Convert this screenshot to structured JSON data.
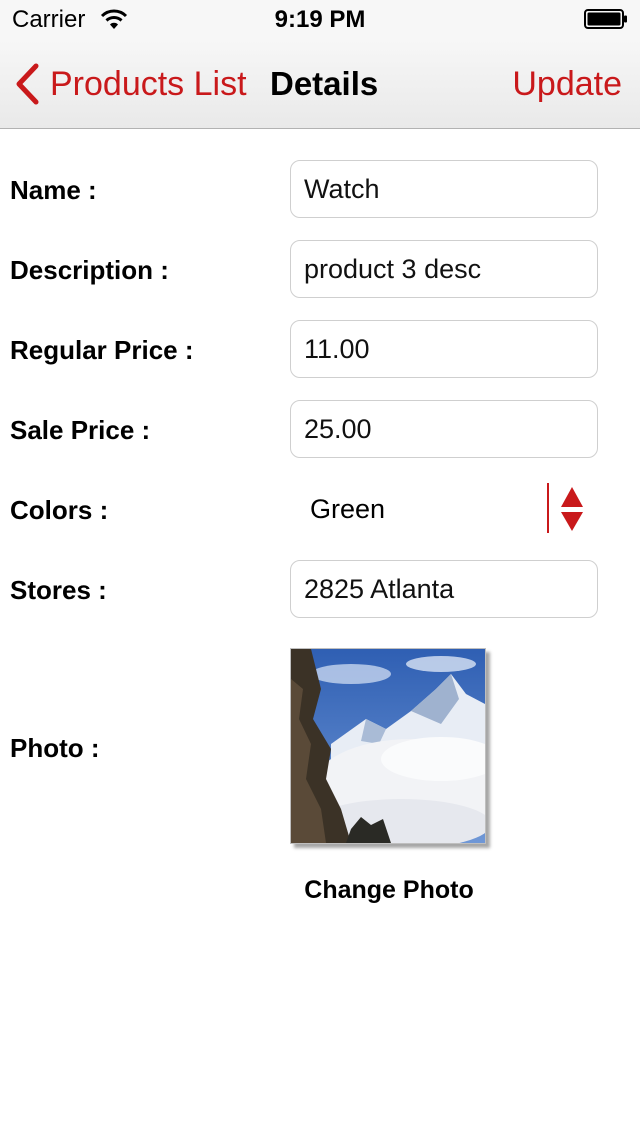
{
  "status_bar": {
    "carrier": "Carrier",
    "time": "9:19 PM"
  },
  "nav": {
    "back_label": "Products List",
    "title": "Details",
    "action_label": "Update"
  },
  "form": {
    "name": {
      "label": "Name :",
      "value": "Watch"
    },
    "description": {
      "label": "Description :",
      "value": "product 3 desc"
    },
    "regular_price": {
      "label": "Regular Price :",
      "value": "11.00"
    },
    "sale_price": {
      "label": "Sale Price :",
      "value": "25.00"
    },
    "colors": {
      "label": "Colors :",
      "value": "Green"
    },
    "stores": {
      "label": "Stores :",
      "value": "2825 Atlanta"
    },
    "photo": {
      "label": "Photo :",
      "button_label": "Change Photo"
    }
  },
  "accent_color": "#c9191b",
  "icons": [
    "wifi-icon",
    "battery-icon",
    "back-chevron-icon",
    "stepper-arrows-icon"
  ]
}
